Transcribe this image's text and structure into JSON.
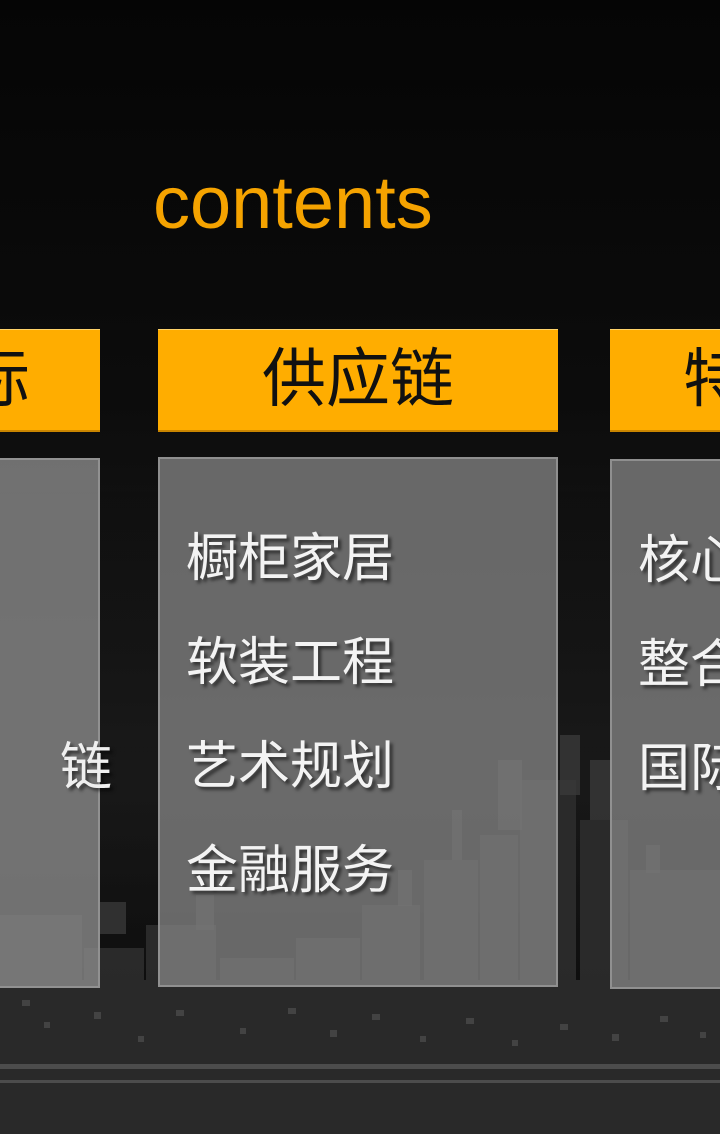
{
  "page": {
    "title": "contents"
  },
  "columns": {
    "left": {
      "header": "际",
      "items": [
        "",
        "",
        "链"
      ]
    },
    "center": {
      "header": "供应链",
      "items": [
        "橱柜家居",
        "软装工程",
        "艺术规划",
        "金融服务"
      ]
    },
    "right": {
      "header": "特",
      "items": [
        "核心",
        "整合",
        "国际"
      ]
    }
  },
  "colors": {
    "accent": "#ffad00",
    "title": "#f5a300",
    "panel": "#808080",
    "background": "#050505"
  }
}
